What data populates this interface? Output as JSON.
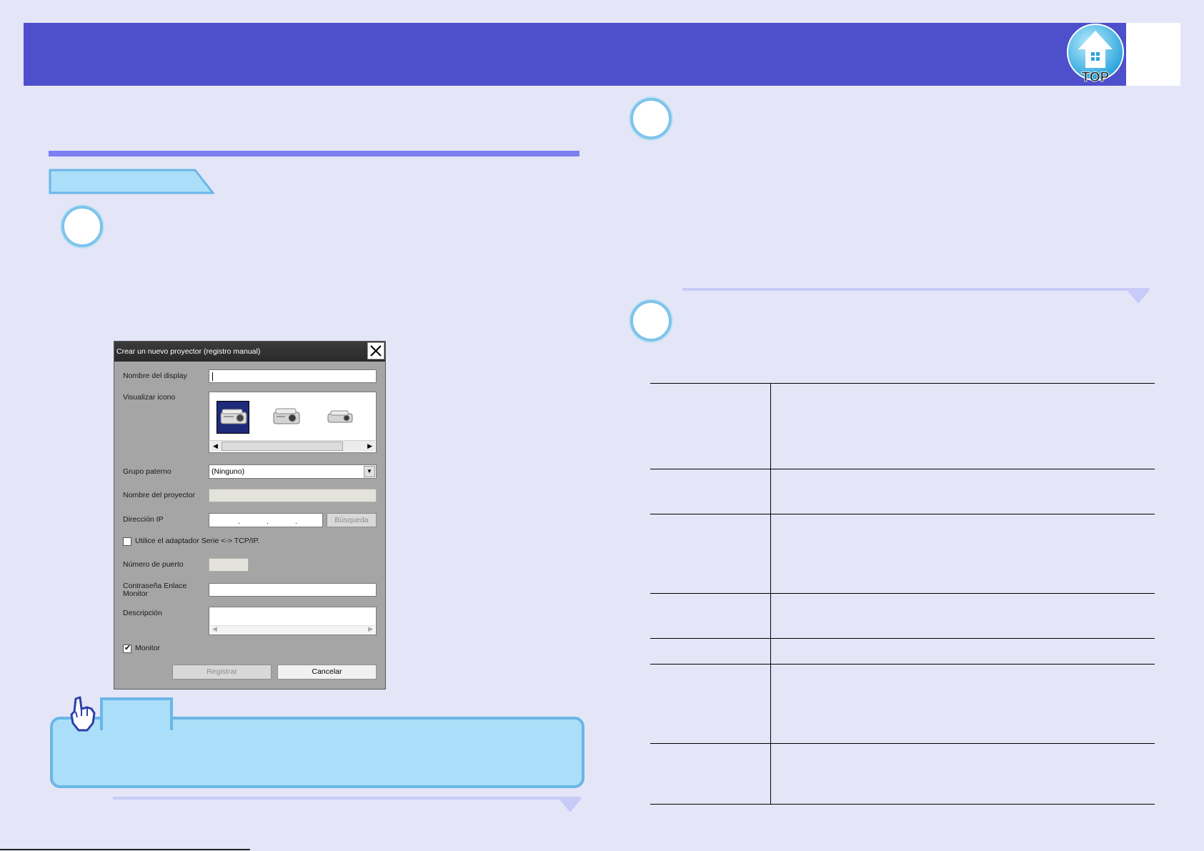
{
  "colors": {
    "header": "#4e4fcb",
    "background": "#e4e6f8",
    "accent_rule": "#7b7ff0",
    "tab_fill": "#abdef8",
    "point_box_fill": "#abdef8",
    "point_box_border": "#6ab6e8"
  },
  "header": {
    "top_button_label": "TOP",
    "top_button_icon": "house-up-arrow-icon"
  },
  "dialog": {
    "title": "Crear un nuevo proyector (registro manual)",
    "close_icon": "close-icon",
    "fields": {
      "display_name_label": "Nombre del display",
      "display_name_value": "",
      "icon_label": "Visualizar icono",
      "icons": [
        "projector-icon-large",
        "projector-icon-medium",
        "projector-icon-small"
      ],
      "selected_icon_index": 0,
      "parent_group_label": "Grupo paterno",
      "parent_group_value": "(Ninguno)",
      "projector_name_label": "Nombre del proyector",
      "projector_name_value": "",
      "ip_label": "Dirección IP",
      "ip_dots": ".  .  .",
      "search_button": "Búsqueda",
      "serial_adapter_label": "Utilice el adaptador Serie <-> TCP/IP.",
      "serial_adapter_checked": false,
      "port_label": "Número de puerto",
      "password_label_line1": "Contraseña Enlace",
      "password_label_line2": "Monitor",
      "description_label": "Descripción",
      "monitor_label": "Monitor",
      "monitor_checked": true
    },
    "buttons": {
      "register": "Registrar",
      "cancel": "Cancelar"
    }
  },
  "point": {
    "hand_icon": "pointing-hand-icon"
  },
  "table": {
    "row_count": 7
  }
}
